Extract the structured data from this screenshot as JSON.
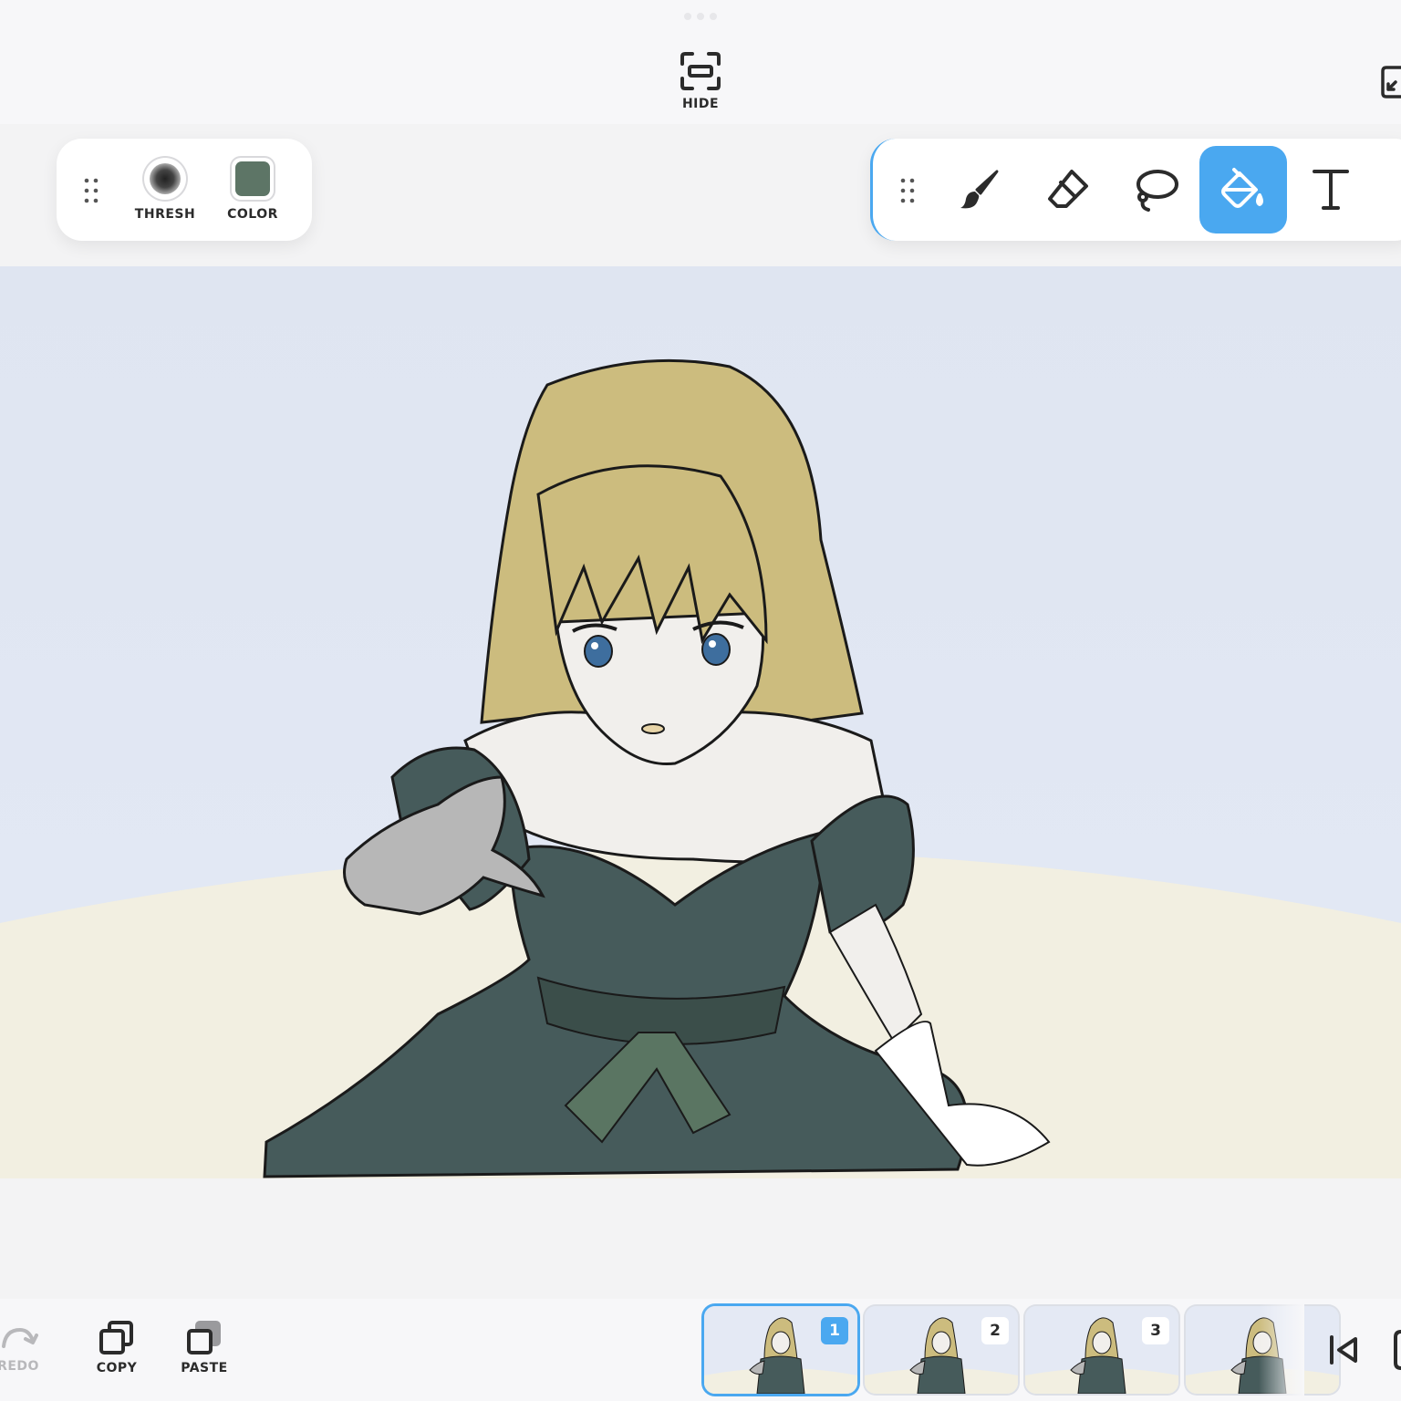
{
  "top": {
    "hide_label": "HIDE"
  },
  "left_panel": {
    "thresh_label": "THRESH",
    "color_label": "COLOR",
    "color_value": "#5d7566"
  },
  "tools": {
    "items": [
      "brush",
      "eraser",
      "lasso",
      "fill-bucket",
      "text"
    ],
    "active": "fill-bucket",
    "accent": "#4aa8f0"
  },
  "bottom": {
    "redo_label": "REDO",
    "copy_label": "COPY",
    "paste_label": "PASTE",
    "frames": [
      "1",
      "2",
      "3"
    ],
    "active_frame": "1"
  }
}
